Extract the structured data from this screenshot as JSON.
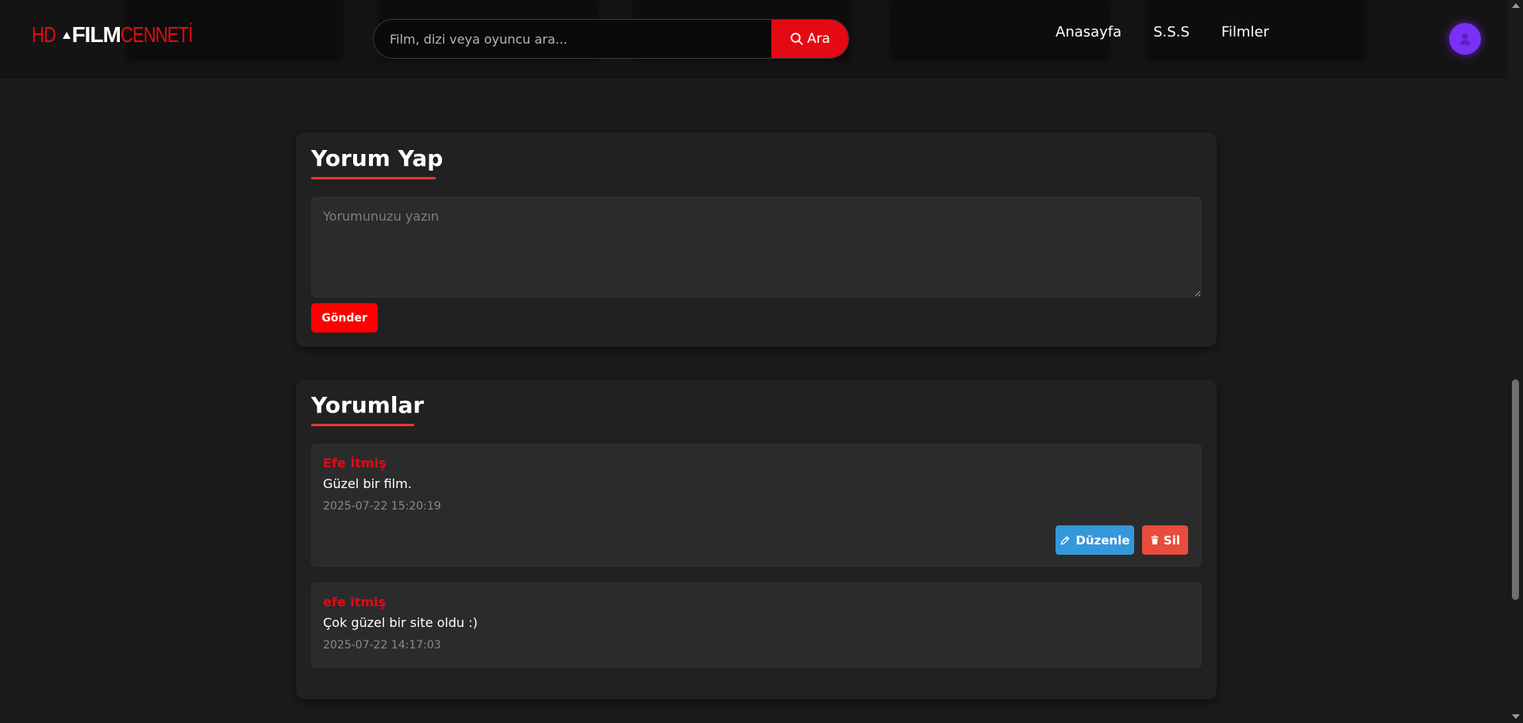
{
  "header": {
    "logo": {
      "part1": "HD",
      "part2": "FILM",
      "part3": "CENNETİ"
    },
    "search": {
      "placeholder": "Film, dizi veya oyuncu ara...",
      "button_label": "Ara"
    },
    "nav": [
      {
        "label": "Anasayfa"
      },
      {
        "label": "S.S.S"
      },
      {
        "label": "Filmler"
      }
    ]
  },
  "comment_form": {
    "title": "Yorum Yap",
    "placeholder": "Yorumunuzu yazın",
    "submit_label": "Gönder"
  },
  "comments_section": {
    "title": "Yorumlar",
    "comments": [
      {
        "author": "Efe İtmiş",
        "text": "Güzel bir film.",
        "date": "2025-07-22 15:20:19",
        "edit_label": "Düzenle",
        "delete_label": "Sil"
      },
      {
        "author": "efe itmiş",
        "text": "Çok güzel bir site oldu :)",
        "date": "2025-07-22 14:17:03"
      }
    ]
  },
  "colors": {
    "accent": "#e50914",
    "edit": "#3498db",
    "delete": "#e74c3c",
    "avatar": "#7b2ff7"
  }
}
